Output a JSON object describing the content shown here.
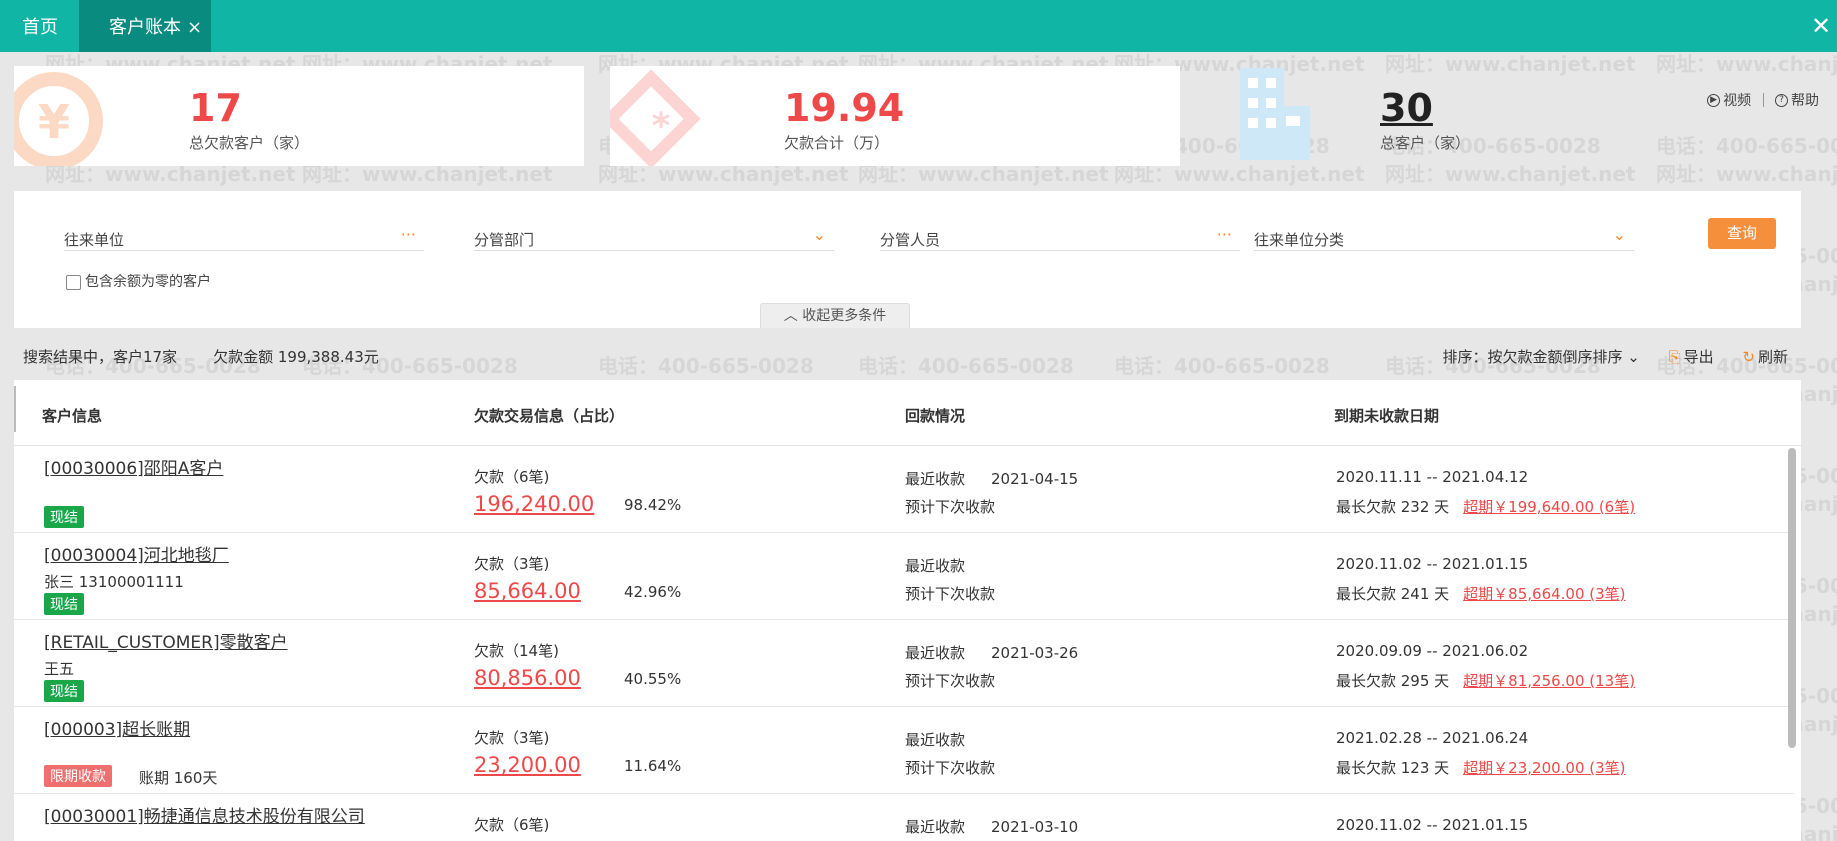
{
  "tabs": {
    "home": "首页",
    "active": "客户账本",
    "close": "×"
  },
  "window_close": "✕",
  "summary": {
    "debt_customers": {
      "value": "17",
      "label": "总欠款客户（家）"
    },
    "debt_total": {
      "value": "19.94",
      "label": "欠款合计（万）"
    },
    "total_customers": {
      "value": "30",
      "label": "总客户（家）"
    }
  },
  "help": {
    "video": "视频",
    "help": "帮助"
  },
  "filters": {
    "partner": "往来单位",
    "dept": "分管部门",
    "staff": "分管人员",
    "partner_category": "往来单位分类",
    "query": "查询",
    "include_zero": "包含余额为零的客户",
    "collapse": "收起更多条件"
  },
  "results": {
    "summary_customers": "搜索结果中，客户17家",
    "summary_amount": "欠款金额 199,388.43元",
    "sort": "排序：按欠款金额倒序排序",
    "export": "导出",
    "refresh": "刷新"
  },
  "table": {
    "headers": [
      "客户信息",
      "欠款交易信息（占比）",
      "回款情况",
      "到期未收款日期"
    ],
    "rows": [
      {
        "name": "[00030006]邵阳A客户",
        "contact": "",
        "badge": "现结",
        "badge_type": "green",
        "term": "",
        "debt_label": "欠款（6笔)",
        "amount": "196,240.00",
        "pct": "98.42%",
        "recent_label": "最近收款",
        "recent_date": "2021-04-15",
        "next_label": "预计下次收款",
        "range": "2020.11.11 -- 2021.04.12",
        "longest": "最长欠款 232 天",
        "overdue": "超期￥199,640.00 (6笔)"
      },
      {
        "name": "[00030004]河北地毯厂",
        "contact": "张三   13100001111",
        "badge": "现结",
        "badge_type": "green",
        "term": "",
        "debt_label": "欠款（3笔)",
        "amount": "85,664.00",
        "pct": "42.96%",
        "recent_label": "最近收款",
        "recent_date": "",
        "next_label": "预计下次收款",
        "range": "2020.11.02 -- 2021.01.15",
        "longest": "最长欠款 241 天",
        "overdue": "超期￥85,664.00 (3笔)"
      },
      {
        "name": "[RETAIL_CUSTOMER]零散客户",
        "contact": "王五",
        "badge": "现结",
        "badge_type": "green",
        "term": "",
        "debt_label": "欠款（14笔)",
        "amount": "80,856.00",
        "pct": "40.55%",
        "recent_label": "最近收款",
        "recent_date": "2021-03-26",
        "next_label": "预计下次收款",
        "range": "2020.09.09 -- 2021.06.02",
        "longest": "最长欠款 295 天",
        "overdue": "超期￥81,256.00 (13笔)"
      },
      {
        "name": "[000003]超长账期",
        "contact": "",
        "badge": "限期收款",
        "badge_type": "red",
        "term": "账期   160天",
        "debt_label": "欠款（3笔)",
        "amount": "23,200.00",
        "pct": "11.64%",
        "recent_label": "最近收款",
        "recent_date": "",
        "next_label": "预计下次收款",
        "range": "2021.02.28 -- 2021.06.24",
        "longest": "最长欠款 123 天",
        "overdue": "超期￥23,200.00 (3笔)"
      },
      {
        "name": "[00030001]畅捷通信息技术股份有限公司",
        "contact": "",
        "badge": "",
        "badge_type": "",
        "term": "",
        "debt_label": "欠款（6笔)",
        "amount": "",
        "pct": "",
        "recent_label": "最近收款",
        "recent_date": "2021-03-10",
        "next_label": "",
        "range": "2020.11.02 -- 2021.01.15",
        "longest": "",
        "overdue": ""
      }
    ]
  },
  "watermark": {
    "phone": "电话：400-665-0028",
    "site": "网址：www.chanjet.net"
  }
}
